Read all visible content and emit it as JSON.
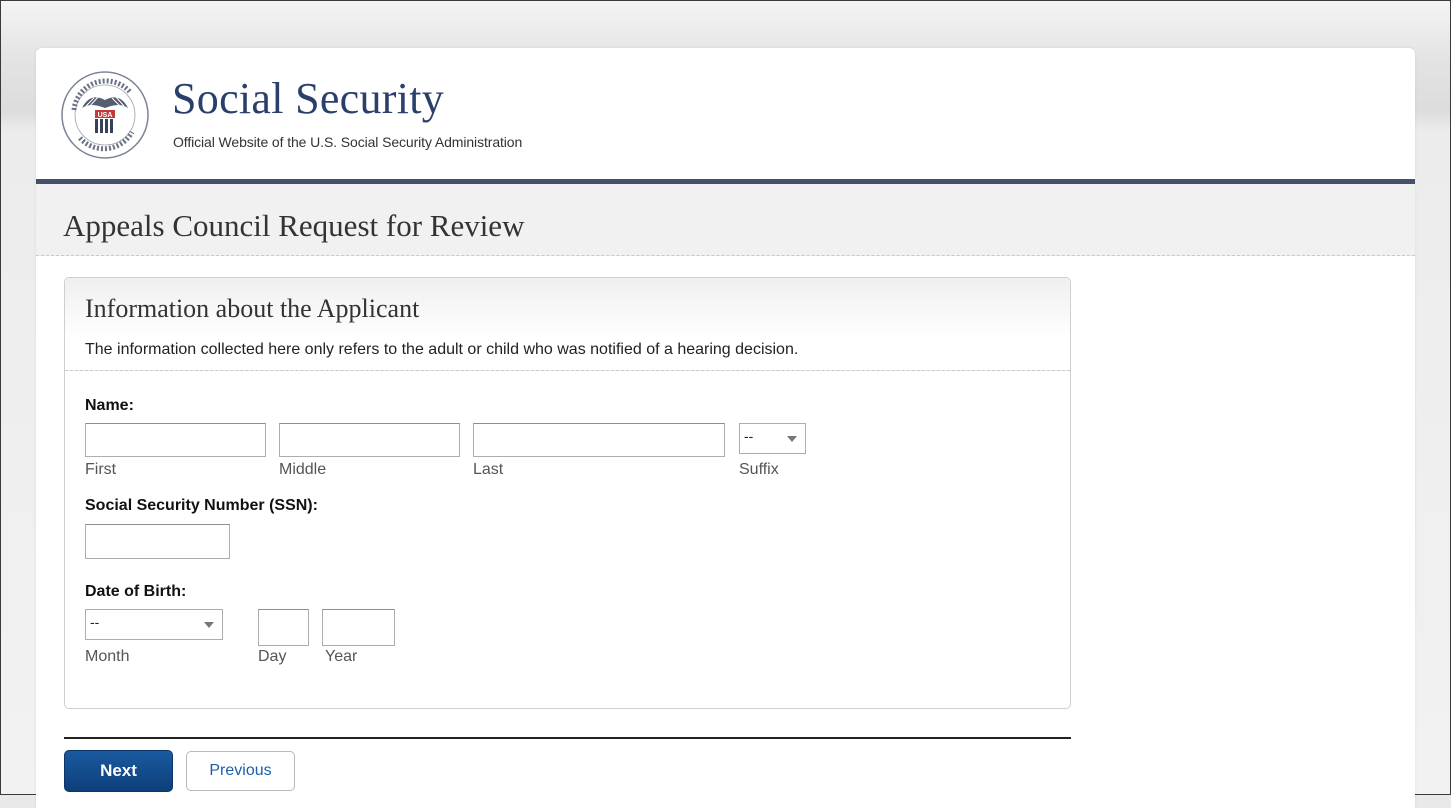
{
  "header": {
    "brand_name": "Social Security",
    "tagline": "Official Website of the U.S. Social Security Administration",
    "seal_icon": "ssa-seal-icon"
  },
  "page": {
    "title": "Appeals Council Request for Review"
  },
  "section": {
    "title": "Information about the Applicant",
    "subtitle": "The information collected here only refers to the adult or child who was notified of a hearing decision."
  },
  "form": {
    "name": {
      "label": "Name:",
      "first_label": "First",
      "first_value": "",
      "middle_label": "Middle",
      "middle_value": "",
      "last_label": "Last",
      "last_value": "",
      "suffix_label": "Suffix",
      "suffix_selected": "--"
    },
    "ssn": {
      "label": "Social Security Number (SSN):",
      "value": ""
    },
    "dob": {
      "label": "Date of Birth:",
      "month_label": "Month",
      "month_selected": "--",
      "day_label": "Day",
      "day_value": "",
      "year_label": "Year",
      "year_value": ""
    }
  },
  "buttons": {
    "next": "Next",
    "previous": "Previous"
  },
  "colors": {
    "brand_navy": "#2b3f6b",
    "header_rule": "#46506b",
    "next_button": "#0d3f7a",
    "link_blue": "#1b5faa"
  }
}
